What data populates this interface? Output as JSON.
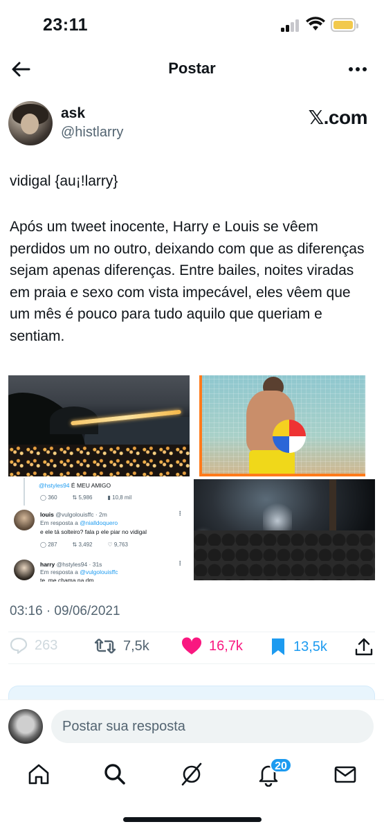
{
  "status_bar": {
    "time": "23:11"
  },
  "header": {
    "title": "Postar"
  },
  "author": {
    "name": "ask",
    "handle": "@histlarry",
    "source": "𝕏.com"
  },
  "post": {
    "title_line": "vidigal {au¡!larry}",
    "body": "Após um tweet inocente, Harry e Louis se vêem perdidos um no outro, deixando com que as diferenças sejam apenas diferenças. Entre bailes, noites viradas em praia e sexo com vista impecável, eles vêem que um mês é pouco para tudo aquilo que queriam e sentiam.",
    "timestamp": "03:16 · 09/06/2021"
  },
  "embedded_thread": {
    "first_reply": {
      "mention": "@hstyles94",
      "text": "É MEU AMIGO",
      "replies": "360",
      "retweets": "5,986",
      "views": "10,8 mil"
    },
    "louis": {
      "name": "louis",
      "meta": "@vulgolouisffc · 2m",
      "reply_prefix": "Em resposta a",
      "reply_to": "@nialldoquero",
      "text": "e ele tá solteiro? fala p ele piar no vidigal",
      "replies": "287",
      "retweets": "3,492",
      "likes": "9,763"
    },
    "harry": {
      "name": "harry",
      "meta": "@hstyles94 · 31s",
      "reply_prefix": "Em resposta a",
      "reply_to": "@vulgolouisffc",
      "text": "te, me chama na dm"
    }
  },
  "stats": {
    "replies": "263",
    "retweets": "7,5k",
    "likes": "16,7k",
    "bookmarks": "13,5k"
  },
  "composer": {
    "placeholder": "Postar sua resposta"
  },
  "tabbar": {
    "notification_count": "20"
  },
  "colors": {
    "accent": "#1d9bf0",
    "like": "#f91880",
    "text": "#0f1419",
    "secondary": "#536471"
  }
}
